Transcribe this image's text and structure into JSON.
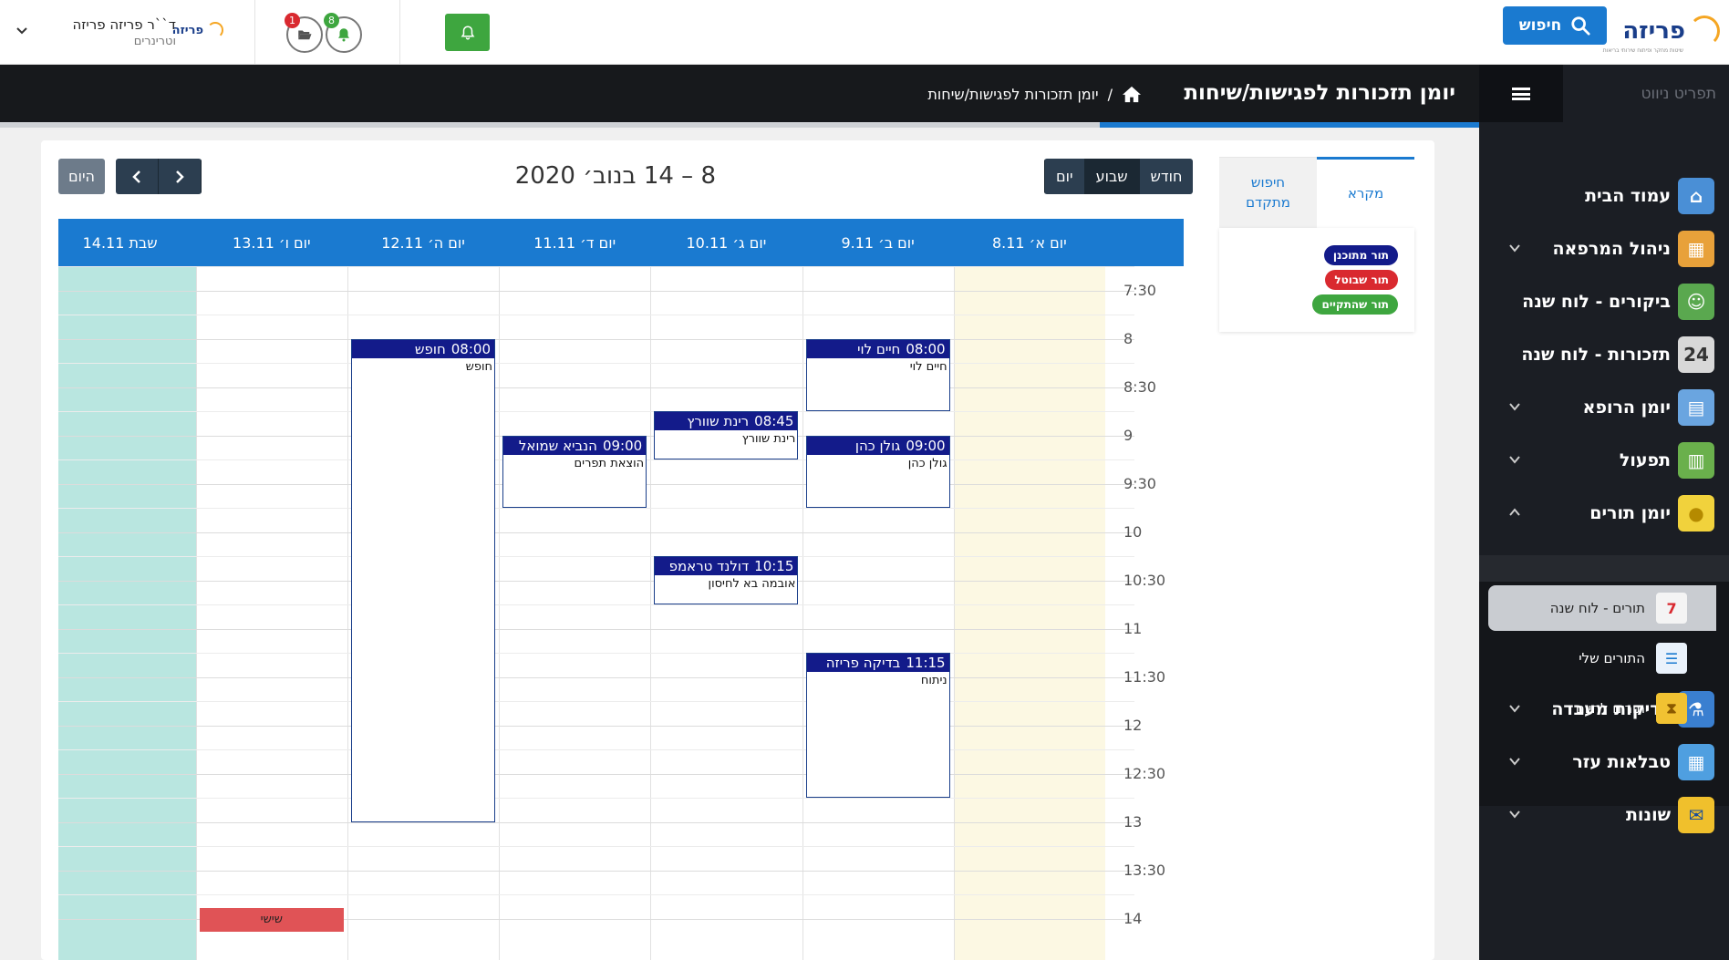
{
  "topbar": {
    "brand": "פריזה",
    "brand_tagline": "שיטות מחקר ופיתוח שירותי בריאות",
    "search_label": "חיפוש",
    "user_name": "ד``ר פריזה פריזה",
    "user_role": "וטרינרים",
    "notif_folder_count": "1",
    "notif_bell_count": "8"
  },
  "sidebar": {
    "nav_title": "תפריט ניווט",
    "items": [
      {
        "label": "עמוד הבית",
        "icon": "home-icon"
      },
      {
        "label": "ניהול המרפאה",
        "icon": "clinic-icon"
      },
      {
        "label": "ביקורים - לוח שנה",
        "icon": "visits-icon"
      },
      {
        "label": "תזכורות - לוח שנה",
        "icon": "calendar-24-icon"
      },
      {
        "label": "יומן הרופא",
        "icon": "doctor-journal-icon"
      },
      {
        "label": "תפעול",
        "icon": "operations-chart-icon"
      },
      {
        "label": "יומן תורים",
        "icon": "lightbulb-icon"
      },
      {
        "label": "בדיקות מעבדה",
        "icon": "microscope-icon"
      },
      {
        "label": "טבלאות עזר",
        "icon": "tables-icon"
      },
      {
        "label": "שונות",
        "icon": "chat-icon"
      }
    ],
    "sub_items": [
      {
        "label": "תורים - לוח שנה",
        "icon": "calendar-7-icon"
      },
      {
        "label": "התורים שלי",
        "icon": "my-appointments-icon"
      },
      {
        "label": "תורים להיום",
        "icon": "hourglass-icon"
      }
    ]
  },
  "header": {
    "title": "יומן תזכורות לפגישות/שיחות",
    "breadcrumb_sep": "/",
    "breadcrumb_current": "יומן תזכורות לפגישות/שיחות"
  },
  "legend": {
    "tab_legend": "מקרא",
    "tab_advanced_line1": "חיפוש",
    "tab_advanced_line2": "מתקדם",
    "planned": "תור מתוכנן",
    "cancelled": "תור שבוטל",
    "done": "תור שהתקיים"
  },
  "calendar": {
    "title": "8 – 14 בנוב׳ 2020",
    "views": {
      "month": "חודש",
      "week": "שבוע",
      "day": "יום"
    },
    "today": "היום",
    "days": [
      "יום א׳ 8.11",
      "יום ב׳ 9.11",
      "יום ג׳ 10.11",
      "יום ד׳ 11.11",
      "יום ה׳ 12.11",
      "יום ו׳ 13.11",
      "שבת 14.11"
    ],
    "times": [
      "7:30",
      "8",
      "8:30",
      "9",
      "9:30",
      "10",
      "10:30",
      "11",
      "11:30",
      "12",
      "12:30",
      "13",
      "13:30",
      "14"
    ],
    "events": [
      {
        "day": 1,
        "time": "08:00",
        "title": "חיים לוי",
        "body": "חיים לוי",
        "start": 8.0,
        "end": 8.75
      },
      {
        "day": 1,
        "time": "09:00",
        "title": "גולן כהן",
        "body": "גולן כהן",
        "start": 9.0,
        "end": 9.75
      },
      {
        "day": 1,
        "time": "11:15",
        "title": "בדיקה פריזה",
        "body": "ניתוח",
        "start": 11.25,
        "end": 12.75
      },
      {
        "day": 2,
        "time": "08:45",
        "title": "רינת שוורץ",
        "body": "רינת שוורץ",
        "start": 8.75,
        "end": 9.25
      },
      {
        "day": 2,
        "time": "10:15",
        "title": "דולנד טראמפ",
        "body": "אובמה בא לחיסון",
        "start": 10.25,
        "end": 10.75
      },
      {
        "day": 3,
        "time": "09:00",
        "title": "הנביא שמואל",
        "body": "הוצאת תפרים",
        "start": 9.0,
        "end": 9.75
      },
      {
        "day": 4,
        "time": "08:00",
        "title": "חופש",
        "body": "חופש",
        "start": 8.0,
        "end": 13.0
      }
    ],
    "cancelled_events": [
      {
        "day": 5,
        "label": "שישי",
        "start": 14.0
      }
    ]
  }
}
